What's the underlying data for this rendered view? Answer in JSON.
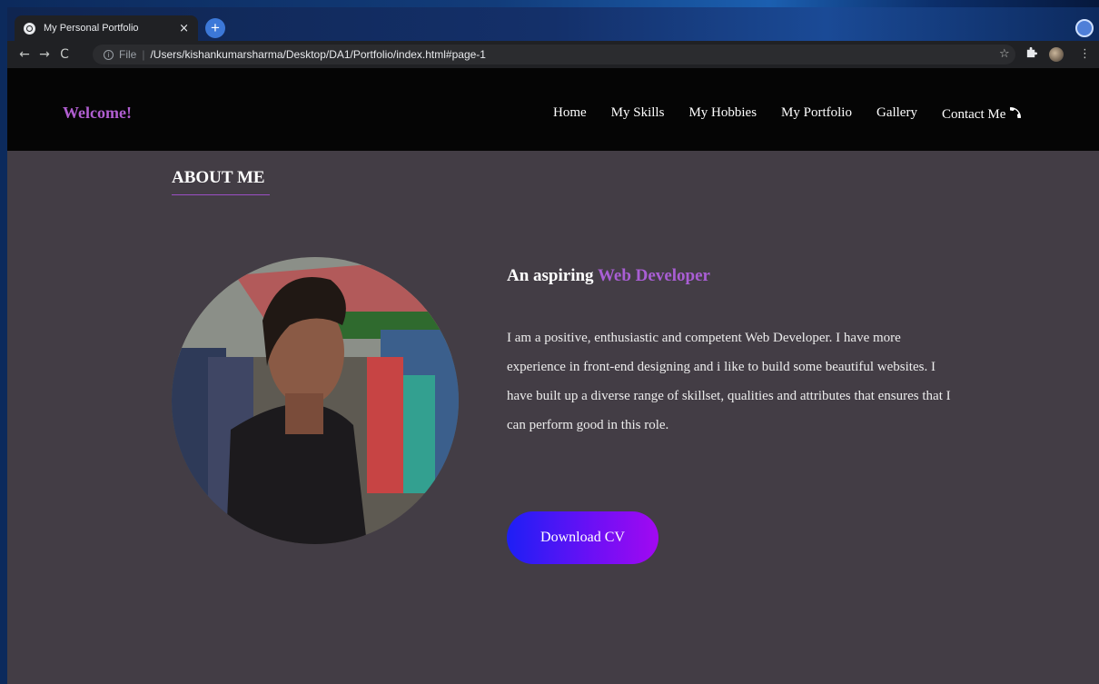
{
  "browser": {
    "tab_title": "My Personal Portfolio",
    "tab_close": "×",
    "new_tab": "+",
    "url_scheme": "File",
    "url_separator": "|",
    "url_path": "/Users/kishankumarsharma/Desktop/DA1/Portfolio/index.html#page-1",
    "back": "←",
    "forward": "→",
    "reload": "C",
    "bookmark": "☆",
    "menu": "⋮",
    "icons": [
      "globe-icon",
      "info-icon",
      "star-icon",
      "puzzle-icon",
      "kebab-menu-icon"
    ]
  },
  "navbar": {
    "brand": "Welcome!",
    "links": [
      "Home",
      "My Skills",
      "My Hobbies",
      "My Portfolio",
      "Gallery",
      "Contact Me"
    ],
    "phone_icon": "phone-icon"
  },
  "about": {
    "title": "ABOUT ME",
    "headline_prefix": "An aspiring",
    "headline_accent": "Web Developer",
    "paragraph": "I am a positive, enthusiastic and competent Web Developer. I have more experience in front-end designing and i like to build some beautiful websites. I have built up a diverse range of skillset, qualities and attributes that ensures that I can perform good in this role.",
    "cv_button": "Download CV"
  },
  "colors": {
    "accent": "#a95ed4",
    "page_background": "#433d45",
    "navbar_background": "#050505",
    "button_gradient_start": "#1d1ff5",
    "button_gradient_end": "#a209f1"
  }
}
